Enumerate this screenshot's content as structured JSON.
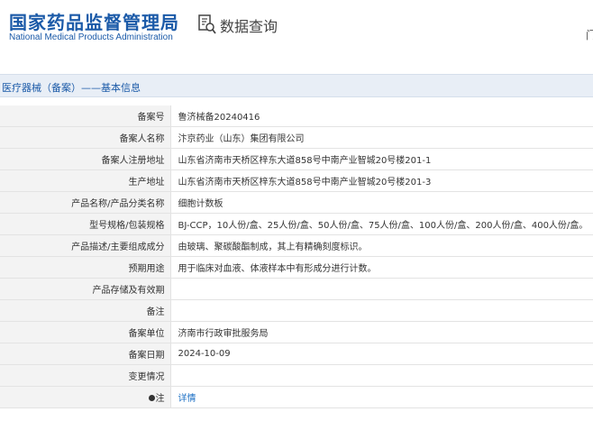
{
  "header": {
    "agency_name": "国家药品监督管理局",
    "agency_name_en": "National Medical Products Administration",
    "query_title": "数据查询",
    "right_edge_text": "门"
  },
  "breadcrumb": "医疗器械（备案）——基本信息",
  "rows": [
    {
      "label": "备案号",
      "value": "鲁济械备20240416"
    },
    {
      "label": "备案人名称",
      "value": "汴京药业（山东）集团有限公司"
    },
    {
      "label": "备案人注册地址",
      "value": "山东省济南市天桥区梓东大道858号中南产业智城20号楼201-1"
    },
    {
      "label": "生产地址",
      "value": "山东省济南市天桥区梓东大道858号中南产业智城20号楼201-3"
    },
    {
      "label": "产品名称/产品分类名称",
      "value": "细胞计数板"
    },
    {
      "label": "型号规格/包装规格",
      "value": "BJ-CCP，10人份/盒、25人份/盒、50人份/盒、75人份/盒、100人份/盒、200人份/盒、400人份/盒。"
    },
    {
      "label": "产品描述/主要组成成分",
      "value": "由玻璃、聚碳酸酯制成，其上有精确刻度标识。"
    },
    {
      "label": "预期用途",
      "value": "用于临床对血液、体液样本中有形成分进行计数。"
    },
    {
      "label": "产品存储及有效期",
      "value": ""
    },
    {
      "label": "备注",
      "value": ""
    },
    {
      "label": "备案单位",
      "value": "济南市行政审批服务局"
    },
    {
      "label": "备案日期",
      "value": "2024-10-09"
    },
    {
      "label": "变更情况",
      "value": ""
    },
    {
      "label": "注",
      "value": "详情"
    }
  ],
  "colors": {
    "brand": "#1b5aa8",
    "link": "#1b6fc4",
    "label_bg": "#f3f3f3",
    "breadcrumb_bg": "#e8eef6"
  }
}
